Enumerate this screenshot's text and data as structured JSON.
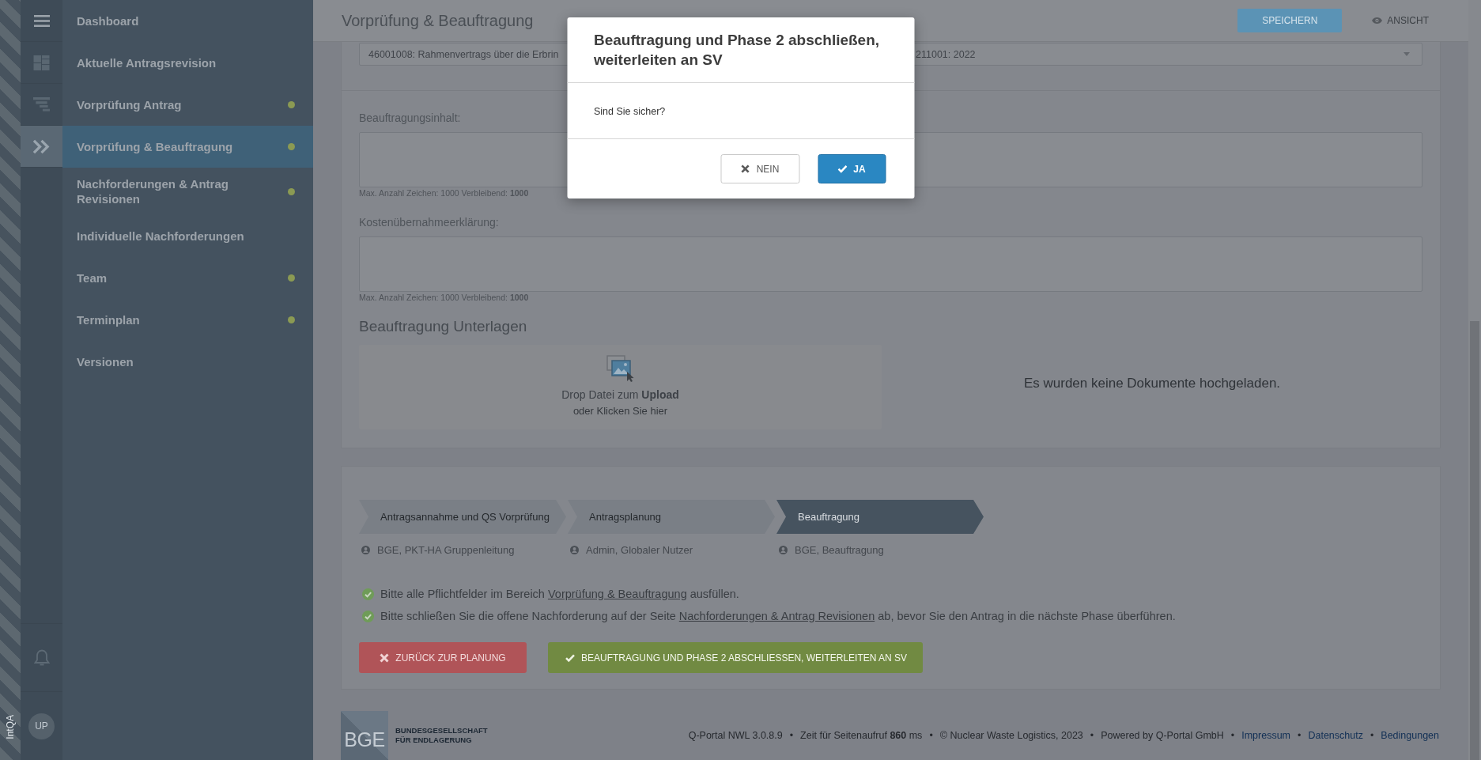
{
  "sidebar": {
    "env_label": "IntQA",
    "rail": [
      {
        "kind": "dashboard",
        "selected": false
      },
      {
        "kind": "list",
        "selected": false
      },
      {
        "kind": "chevrons",
        "selected": true
      }
    ],
    "avatar": {
      "initials": "UP"
    },
    "menu": [
      {
        "label": "Dashboard",
        "selected": false,
        "indicator": false
      },
      {
        "label": "Aktuelle Antragsrevision",
        "selected": false,
        "indicator": false
      },
      {
        "label": "Vorprüfung Antrag",
        "selected": false,
        "indicator": true
      },
      {
        "label": "Vorprüfung & Beauftragung",
        "selected": true,
        "indicator": true
      },
      {
        "label": "Nachforderungen & Antrag Revisionen",
        "selected": false,
        "indicator": true
      },
      {
        "label": "Individuelle Nachforderungen",
        "selected": false,
        "indicator": false
      },
      {
        "label": "Team",
        "selected": false,
        "indicator": true
      },
      {
        "label": "Terminplan",
        "selected": false,
        "indicator": true
      },
      {
        "label": "Versionen",
        "selected": false,
        "indicator": false
      }
    ]
  },
  "header": {
    "title": "Vorprüfung & Beauftragung",
    "buttons": [
      {
        "kind": "primary",
        "label": "SPEICHERN"
      },
      {
        "kind": "view",
        "label": "ANSICHT"
      }
    ]
  },
  "contract_select": {
    "value_parts": [
      "46001008: Rahmenvertrags über die Erbrin",
      "211001: 2022"
    ]
  },
  "fields": [
    {
      "label": "Beauftragungsinhalt:",
      "hint": "Max. Anzahl Zeichen: 1000 Verbleibend: **1000**"
    },
    {
      "label": "Kostenübernahmeerklärung:",
      "hint": "Max. Anzahl Zeichen: 1000 Verbleibend: **1000**"
    }
  ],
  "documents": {
    "heading": "Beauftragung Unterlagen",
    "dropzone": {
      "line_1": "Drop Datei zum **Upload**",
      "line_2": "oder Klicken Sie hier"
    },
    "empty_text": "Es wurden keine Dokumente hochgeladen."
  },
  "workflow": {
    "steps": [
      {
        "label": "Antragsannahme und QS Vorprüfung",
        "active": false,
        "assignee": "BGE, PKT-HA Gruppenleitung"
      },
      {
        "label": "Antragsplanung",
        "active": false,
        "assignee": "Admin, Globaler Nutzer"
      },
      {
        "label": "Beauftragung",
        "active": true,
        "assignee": "BGE, Beauftragung"
      }
    ],
    "messages": [
      {
        "done": true,
        "before": "Bitte alle Pflichtfelder im Bereich",
        "link": "Vorprüfung & Beauftragung",
        "after": "ausfüllen."
      },
      {
        "done": true,
        "before": "Bitte schließen Sie die offene Nachforderung auf der Seite",
        "link": "Nachforderungen & Antrag Revisionen",
        "after": "ab, bevor Sie den Antrag in die nächste Phase überführen."
      }
    ],
    "buttons": [
      {
        "kind": "danger",
        "label": "ZURÜCK ZUR PLANUNG"
      },
      {
        "kind": "success",
        "label": "BEAUFTRAGUNG UND PHASE 2 ABSCHLIESSEN, WEITERLEITEN AN SV"
      }
    ]
  },
  "footer": {
    "logo": {
      "mark": "BGE",
      "lines": [
        "BUNDESGESELLSCHAFT",
        "FÜR ENDLAGERUNG"
      ]
    },
    "separator": "•",
    "items": [
      {
        "kind": "text",
        "text": "Q-Portal NWL 3.0.8.9"
      },
      {
        "kind": "text",
        "text": "Zeit für Seitenaufruf **860** ms"
      },
      {
        "kind": "text",
        "text": "© Nuclear Waste Logistics, 2023"
      },
      {
        "kind": "text",
        "text": "Powered by Q-Portal GmbH"
      },
      {
        "kind": "link",
        "text": "Impressum"
      },
      {
        "kind": "link",
        "text": "Datenschutz"
      },
      {
        "kind": "link",
        "text": "Bedingungen"
      }
    ]
  },
  "dialog": {
    "title": "Beauftragung und Phase 2 abschließen, weiterleiten an SV",
    "message": "Sind Sie sicher?",
    "buttons": [
      {
        "kind": "cancel",
        "label": "NEIN"
      },
      {
        "kind": "confirm",
        "label": "JA"
      }
    ]
  }
}
